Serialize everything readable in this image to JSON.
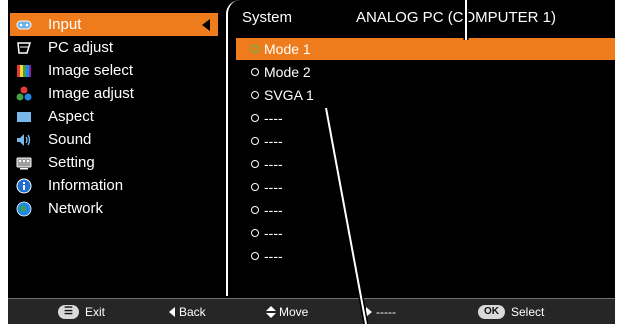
{
  "left_menu": {
    "items": [
      {
        "label": "Input",
        "icon": "input-icon",
        "active": true
      },
      {
        "label": "PC adjust",
        "icon": "pc-adjust-icon"
      },
      {
        "label": "Image select",
        "icon": "image-select-icon"
      },
      {
        "label": "Image adjust",
        "icon": "image-adjust-icon"
      },
      {
        "label": "Aspect",
        "icon": "aspect-icon"
      },
      {
        "label": "Sound",
        "icon": "sound-icon"
      },
      {
        "label": "Setting",
        "icon": "setting-icon"
      },
      {
        "label": "Information",
        "icon": "information-icon"
      },
      {
        "label": "Network",
        "icon": "network-icon"
      }
    ]
  },
  "panel": {
    "header_label": "System",
    "source_label": "ANALOG PC (COMPUTER 1)",
    "options": [
      {
        "label": "Mode 1",
        "active": true
      },
      {
        "label": "Mode 2"
      },
      {
        "label": "SVGA 1"
      },
      {
        "label": "----"
      },
      {
        "label": "----"
      },
      {
        "label": "----"
      },
      {
        "label": "----"
      },
      {
        "label": "----"
      },
      {
        "label": "----"
      },
      {
        "label": "----"
      }
    ]
  },
  "bottom_bar": {
    "exit_key": "☰",
    "exit_label": "Exit",
    "back_label": "Back",
    "move_label": "Move",
    "next_label": "-----",
    "select_key": "OK",
    "select_label": "Select"
  },
  "colors": {
    "accent": "#ee7c1c",
    "background": "#000000",
    "bar": "#262626"
  }
}
